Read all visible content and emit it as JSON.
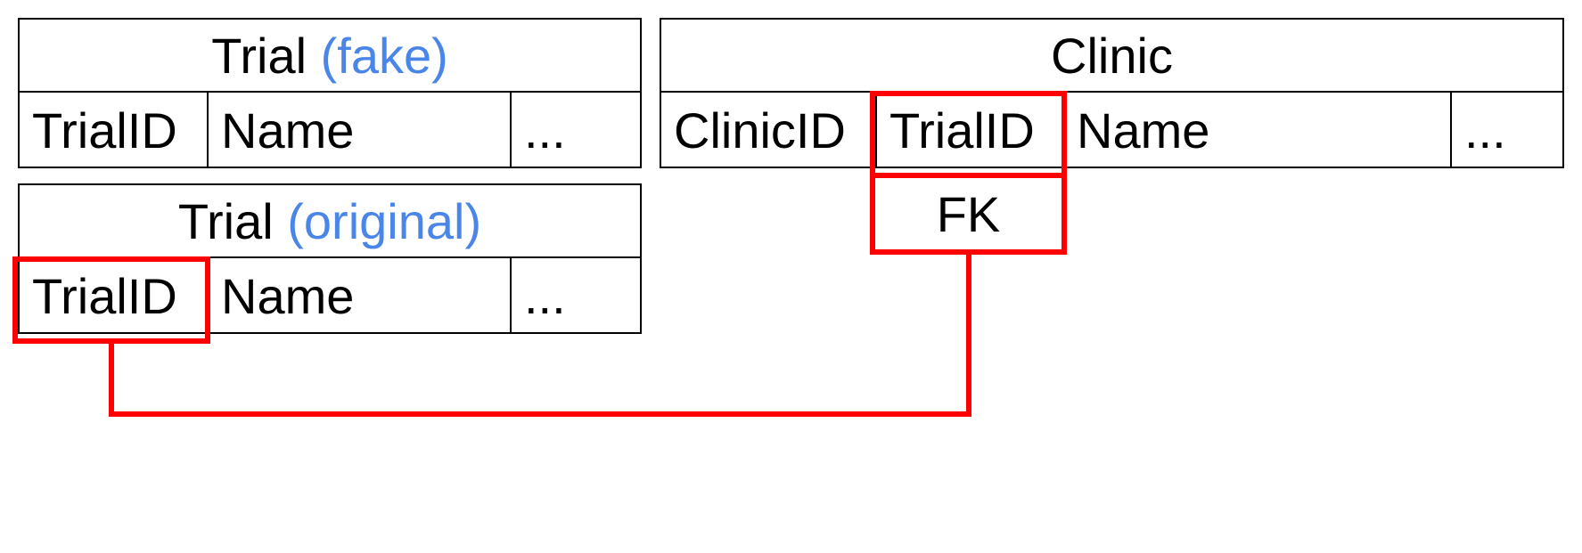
{
  "tables": {
    "trial_fake": {
      "title_name": "Trial",
      "title_annot": "(fake)",
      "columns": [
        "TrialID",
        "Name",
        "..."
      ]
    },
    "trial_original": {
      "title_name": "Trial",
      "title_annot": "(original)",
      "columns": [
        "TrialID",
        "Name",
        "..."
      ]
    },
    "clinic": {
      "title_name": "Clinic",
      "columns": [
        "ClinicID",
        "TrialID",
        "Name",
        "..."
      ]
    }
  },
  "fk_label": "FK",
  "relationship": {
    "from_table": "trial_original",
    "from_column": "TrialID",
    "to_table": "clinic",
    "to_column": "TrialID",
    "type": "foreign_key"
  },
  "colors": {
    "annotation": "#4a86e8",
    "highlight": "#ff0000"
  }
}
